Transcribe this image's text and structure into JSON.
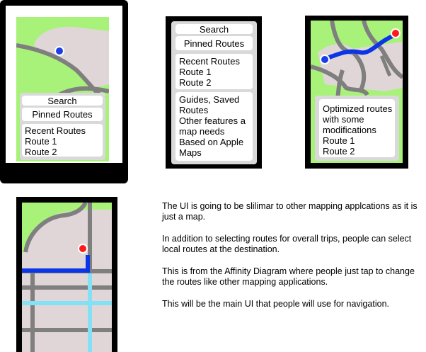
{
  "mockup_1": {
    "search_label": "Search",
    "pinned_label": "Pinned Routes",
    "recent_lines": [
      "Recent Routes",
      "Route 1",
      "Route 2"
    ]
  },
  "mockup_2": {
    "search_label": "Search",
    "pinned_label": "Pinned Routes",
    "recent_lines": [
      "Recent Routes",
      "Route 1",
      "Route 2"
    ],
    "features_lines": [
      "Guides, Saved",
      "Routes",
      "Other features a",
      "map needs",
      "Based on Apple",
      "Maps"
    ]
  },
  "mockup_3": {
    "info_lines": [
      "Optimized routes",
      "with some",
      "modifications",
      "Route 1",
      "Route 2"
    ]
  },
  "notes": [
    "The UI is going to be slilimar to other mapping applcations as it is just a map.",
    "In addition to selecting routes for overall trips, people can select local routes at the destination.",
    "This is from the Affinity Diagram where people just tap to change the routes like other mapping applications.",
    "This will be the main UI that people will use for navigation."
  ],
  "colors": {
    "map_green": "#a8f27a",
    "area_grey": "#e0d6d8",
    "road_grey": "#7f7f7f",
    "route_blue": "#0b35e6",
    "route_light_blue": "#84e0f5",
    "pin_red": "#ff1a1a",
    "pin_blue": "#1a3fe6",
    "panel_grey": "#d9d9d9"
  },
  "icons": [
    "location-dot-icon",
    "destination-pin-icon",
    "home-button-icon"
  ]
}
